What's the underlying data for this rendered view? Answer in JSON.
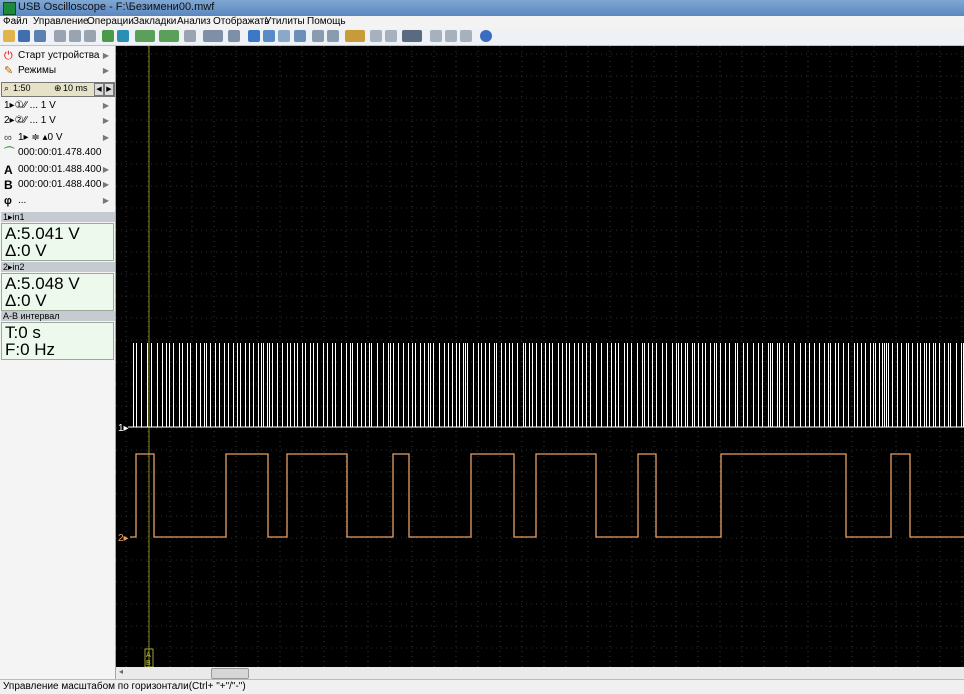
{
  "window": {
    "title": "USB Oscilloscope - F:\\Безимени00.mwf"
  },
  "menu": [
    "Файл",
    "Управление",
    "Операции",
    "Закладки",
    "Анализ",
    "Отображать",
    "Утилиты",
    "Помощь"
  ],
  "panel": {
    "start_device": "Старт устройства",
    "modes": "Режимы",
    "zoom_ratio": "1:50",
    "time_div": "10 ms",
    "ch1_row": "1▸①∕∕ ... 1 V",
    "ch2_row": "2▸②∕∕ ... 1 V",
    "trigger_row": "1▸ ≑ ▴0 V",
    "cursor_delta_time": "000:00:01.478.400",
    "cursor_a_time": "000:00:01.488.400",
    "cursor_b_time": "000:00:01.488.400",
    "phase_value": "..."
  },
  "measurements": {
    "ch1_header": "1▸in1",
    "ch1_a": "A:5.041 V",
    "ch1_delta": "Δ:0 V",
    "ch2_header": "2▸in2",
    "ch2_a": "A:5.048 V",
    "ch2_delta": "Δ:0 V",
    "ab_header": "A-B интервал",
    "ab_t": "T:0 s",
    "ab_f": "F:0 Hz"
  },
  "scope": {
    "ch1_marker": "1▸",
    "ch2_marker": "2▸",
    "cursor_labels": [
      "A",
      "B"
    ],
    "ch1_color": "#ffffff",
    "ch2_color": "#e8a062",
    "grid_color": "#5c5c5c",
    "cursor_color": "#8a8a1e"
  },
  "status_text": "Управление масштабом по горизонтали(Ctrl+ \"+\"/\"-\")"
}
